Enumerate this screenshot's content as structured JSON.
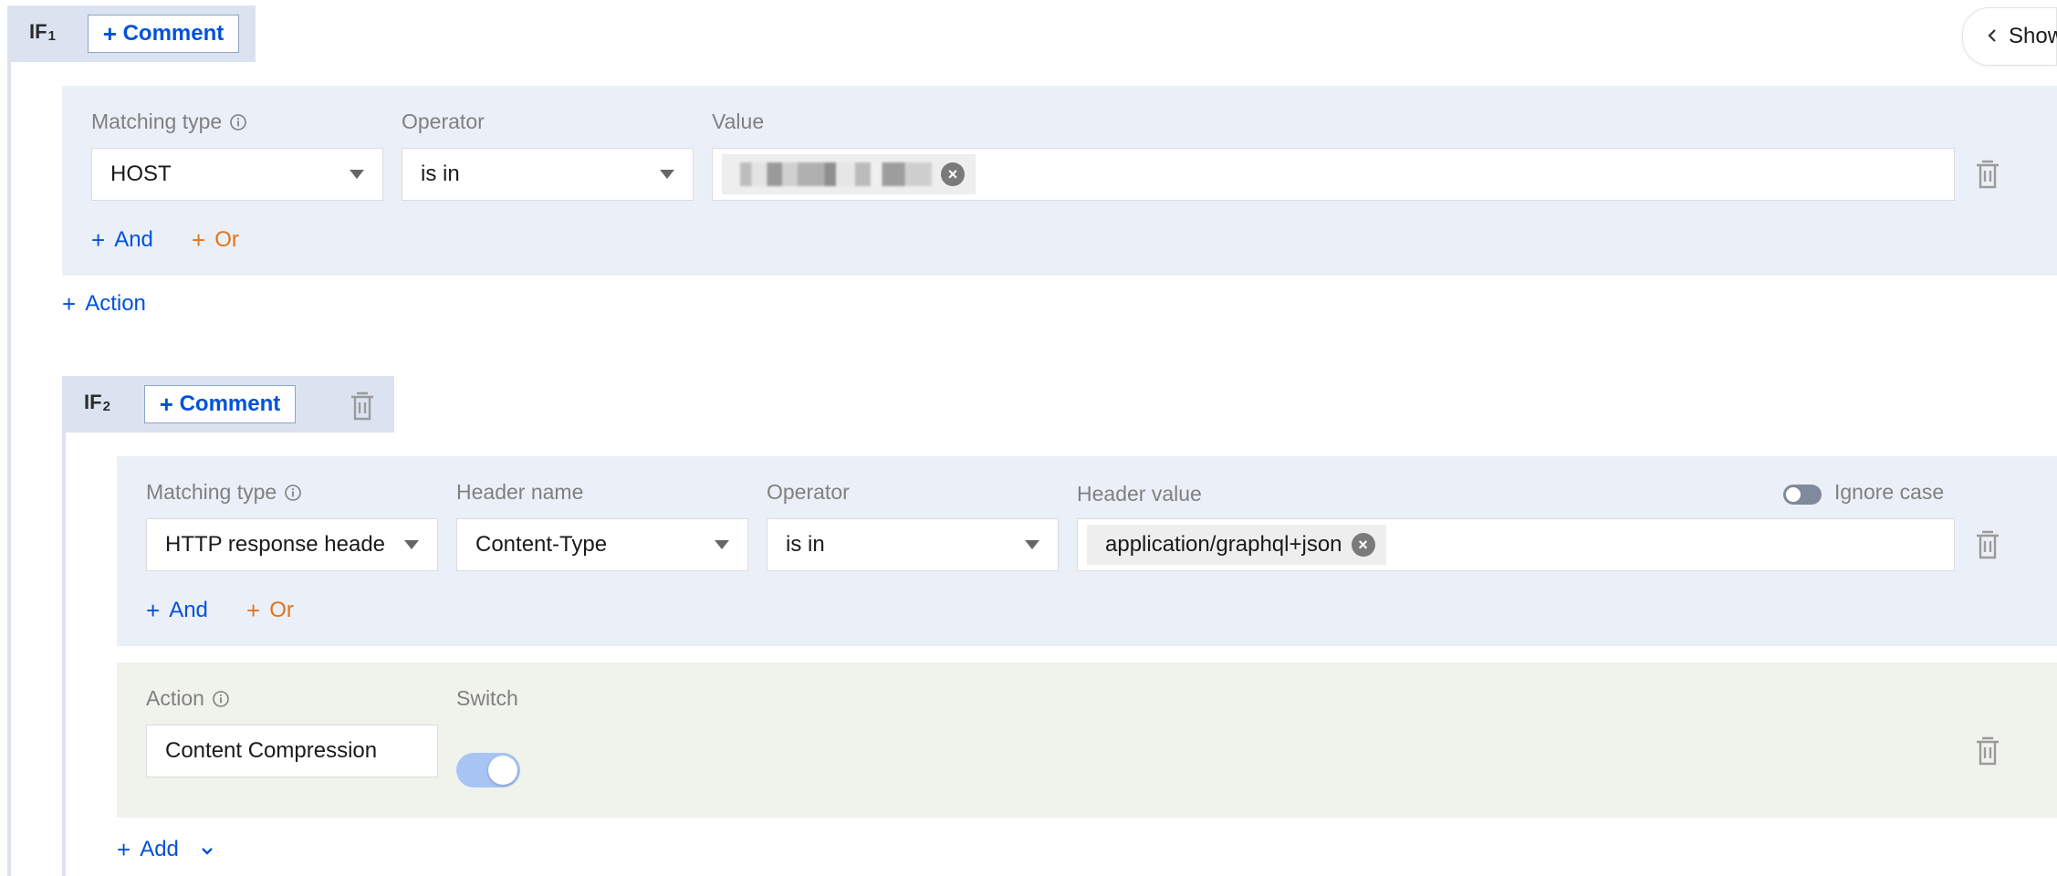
{
  "rule1": {
    "tag_main": "IF",
    "tag_sub": "1",
    "comment_button": "Comment",
    "condition": {
      "matching_type_label": "Matching type",
      "operator_label": "Operator",
      "value_label": "Value",
      "matching_type_value": "HOST",
      "operator_value": "is in",
      "and_label": "And",
      "or_label": "Or"
    },
    "action_link": "Action"
  },
  "rule2": {
    "tag_main": "IF",
    "tag_sub": "2",
    "comment_button": "Comment",
    "condition": {
      "matching_type_label": "Matching type",
      "header_name_label": "Header name",
      "operator_label": "Operator",
      "header_value_label": "Header value",
      "ignore_case_label": "Ignore case",
      "matching_type_value": "HTTP response heade",
      "header_name_value": "Content-Type",
      "operator_value": "is in",
      "header_value_tag": "application/graphql+json",
      "and_label": "And",
      "or_label": "Or"
    },
    "action": {
      "action_label": "Action",
      "switch_label": "Switch",
      "action_value": "Content Compression",
      "switch_on": true
    },
    "add_link": "Add"
  },
  "show_button": "Show",
  "icons": {
    "info": "info-circle-icon",
    "trash": "trash-icon",
    "caret": "caret-down-icon",
    "clear": "clear-circle-icon",
    "chevron_left": "chevron-left-icon",
    "chevron_down": "chevron-down-icon"
  },
  "colors": {
    "primary": "#0052d9",
    "or_accent": "#e37318",
    "condition_bg": "#ebeff7",
    "action_bg": "#f0f3ec",
    "switch_on": "#a8c4f5"
  }
}
